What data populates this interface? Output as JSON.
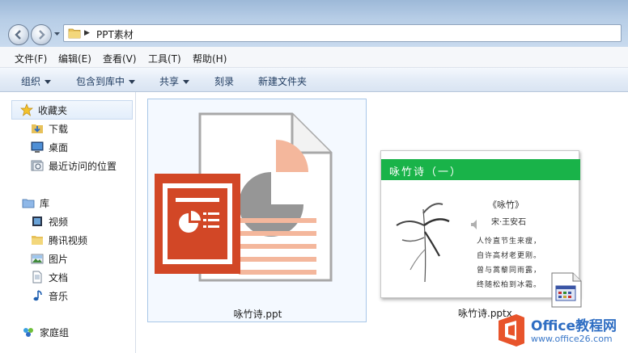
{
  "address": {
    "path": "PPT素材"
  },
  "menu": [
    "文件(F)",
    "编辑(E)",
    "查看(V)",
    "工具(T)",
    "帮助(H)"
  ],
  "commands": {
    "organize": "组织",
    "include_library": "包含到库中",
    "share": "共享",
    "burn": "刻录",
    "new_folder": "新建文件夹"
  },
  "sidebar": {
    "favorites": "收藏夹",
    "downloads": "下载",
    "desktop": "桌面",
    "recent": "最近访问的位置",
    "library": "库",
    "videos": "视频",
    "tencent_video": "腾讯视频",
    "pictures": "图片",
    "documents": "文档",
    "music": "音乐",
    "homegroup": "家庭组"
  },
  "files": [
    {
      "name": "咏竹诗.ppt"
    },
    {
      "name": "咏竹诗.pptx"
    }
  ],
  "slide": {
    "title": "咏竹诗（一）",
    "poem_title": "《咏竹》",
    "author": "宋·王安石",
    "lines": [
      "人怜直节生来瘦，",
      "自许高材老更刚。",
      "曾与蒿藜同雨露，",
      "终随松柏到冰霜。"
    ]
  },
  "watermark": {
    "brand": "Office教程网",
    "site": "www.office26.com"
  },
  "colors": {
    "ppt_red": "#d24726",
    "ppt_peach": "#f4b79c",
    "slide_green": "#19b349",
    "brand_orange": "#e8542b",
    "brand_blue": "#2f6ec3"
  }
}
